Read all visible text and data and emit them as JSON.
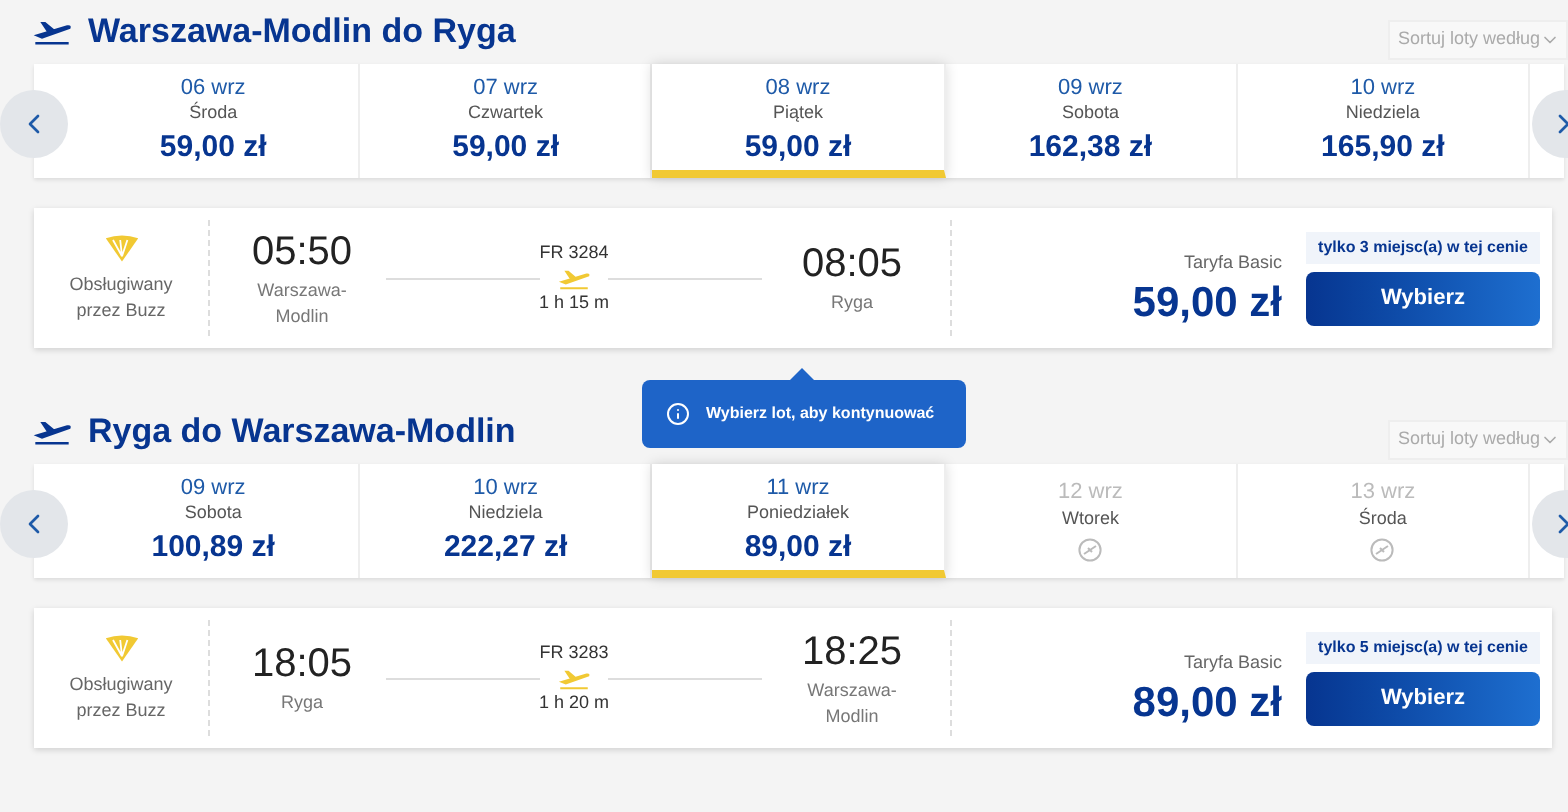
{
  "sections": [
    {
      "title": "Warszawa-Modlin do Ryga",
      "sort": {
        "placeholder": "Sortuj loty według"
      },
      "dates": [
        {
          "kind": "price",
          "date": "06 wrz",
          "day": "Środa",
          "price": "59,00 zł",
          "selected": false
        },
        {
          "kind": "price",
          "date": "07 wrz",
          "day": "Czwartek",
          "price": "59,00 zł",
          "selected": false
        },
        {
          "kind": "price",
          "date": "08 wrz",
          "day": "Piątek",
          "price": "59,00 zł",
          "selected": true
        },
        {
          "kind": "price",
          "date": "09 wrz",
          "day": "Sobota",
          "price": "162,38 zł",
          "selected": false
        },
        {
          "kind": "price",
          "date": "10 wrz",
          "day": "Niedziela",
          "price": "165,90 zł",
          "selected": false
        }
      ],
      "flight": {
        "operator": "Obsługiwany przez Buzz",
        "dep_time": "05:50",
        "dep_city": "Warszawa-Modlin",
        "number": "FR 3284",
        "duration": "1 h 15 m",
        "arr_time": "08:05",
        "arr_city": "Ryga",
        "seats": "tylko 3 miejsc(a) w tej cenie",
        "fare": "Taryfa Basic",
        "price": "59,00 zł",
        "button": "Wybierz"
      }
    },
    {
      "title": "Ryga do Warszawa-Modlin",
      "sort": {
        "placeholder": "Sortuj loty według"
      },
      "dates": [
        {
          "kind": "price",
          "date": "09 wrz",
          "day": "Sobota",
          "price": "100,89 zł",
          "selected": false
        },
        {
          "kind": "price",
          "date": "10 wrz",
          "day": "Niedziela",
          "price": "222,27 zł",
          "selected": false
        },
        {
          "kind": "price",
          "date": "11 wrz",
          "day": "Poniedziałek",
          "price": "89,00 zł",
          "selected": true
        },
        {
          "kind": "none",
          "date": "12 wrz",
          "day": "Wtorek",
          "selected": false
        },
        {
          "kind": "none",
          "date": "13 wrz",
          "day": "Środa",
          "selected": false
        }
      ],
      "flight": {
        "operator": "Obsługiwany przez Buzz",
        "dep_time": "18:05",
        "dep_city": "Ryga",
        "number": "FR 3283",
        "duration": "1 h 20 m",
        "arr_time": "18:25",
        "arr_city": "Warszawa-Modlin",
        "seats": "tylko 5 miejsc(a) w tej cenie",
        "fare": "Taryfa Basic",
        "price": "89,00 zł",
        "button": "Wybierz"
      }
    }
  ],
  "tooltip": "Wybierz lot, aby kontynuować"
}
